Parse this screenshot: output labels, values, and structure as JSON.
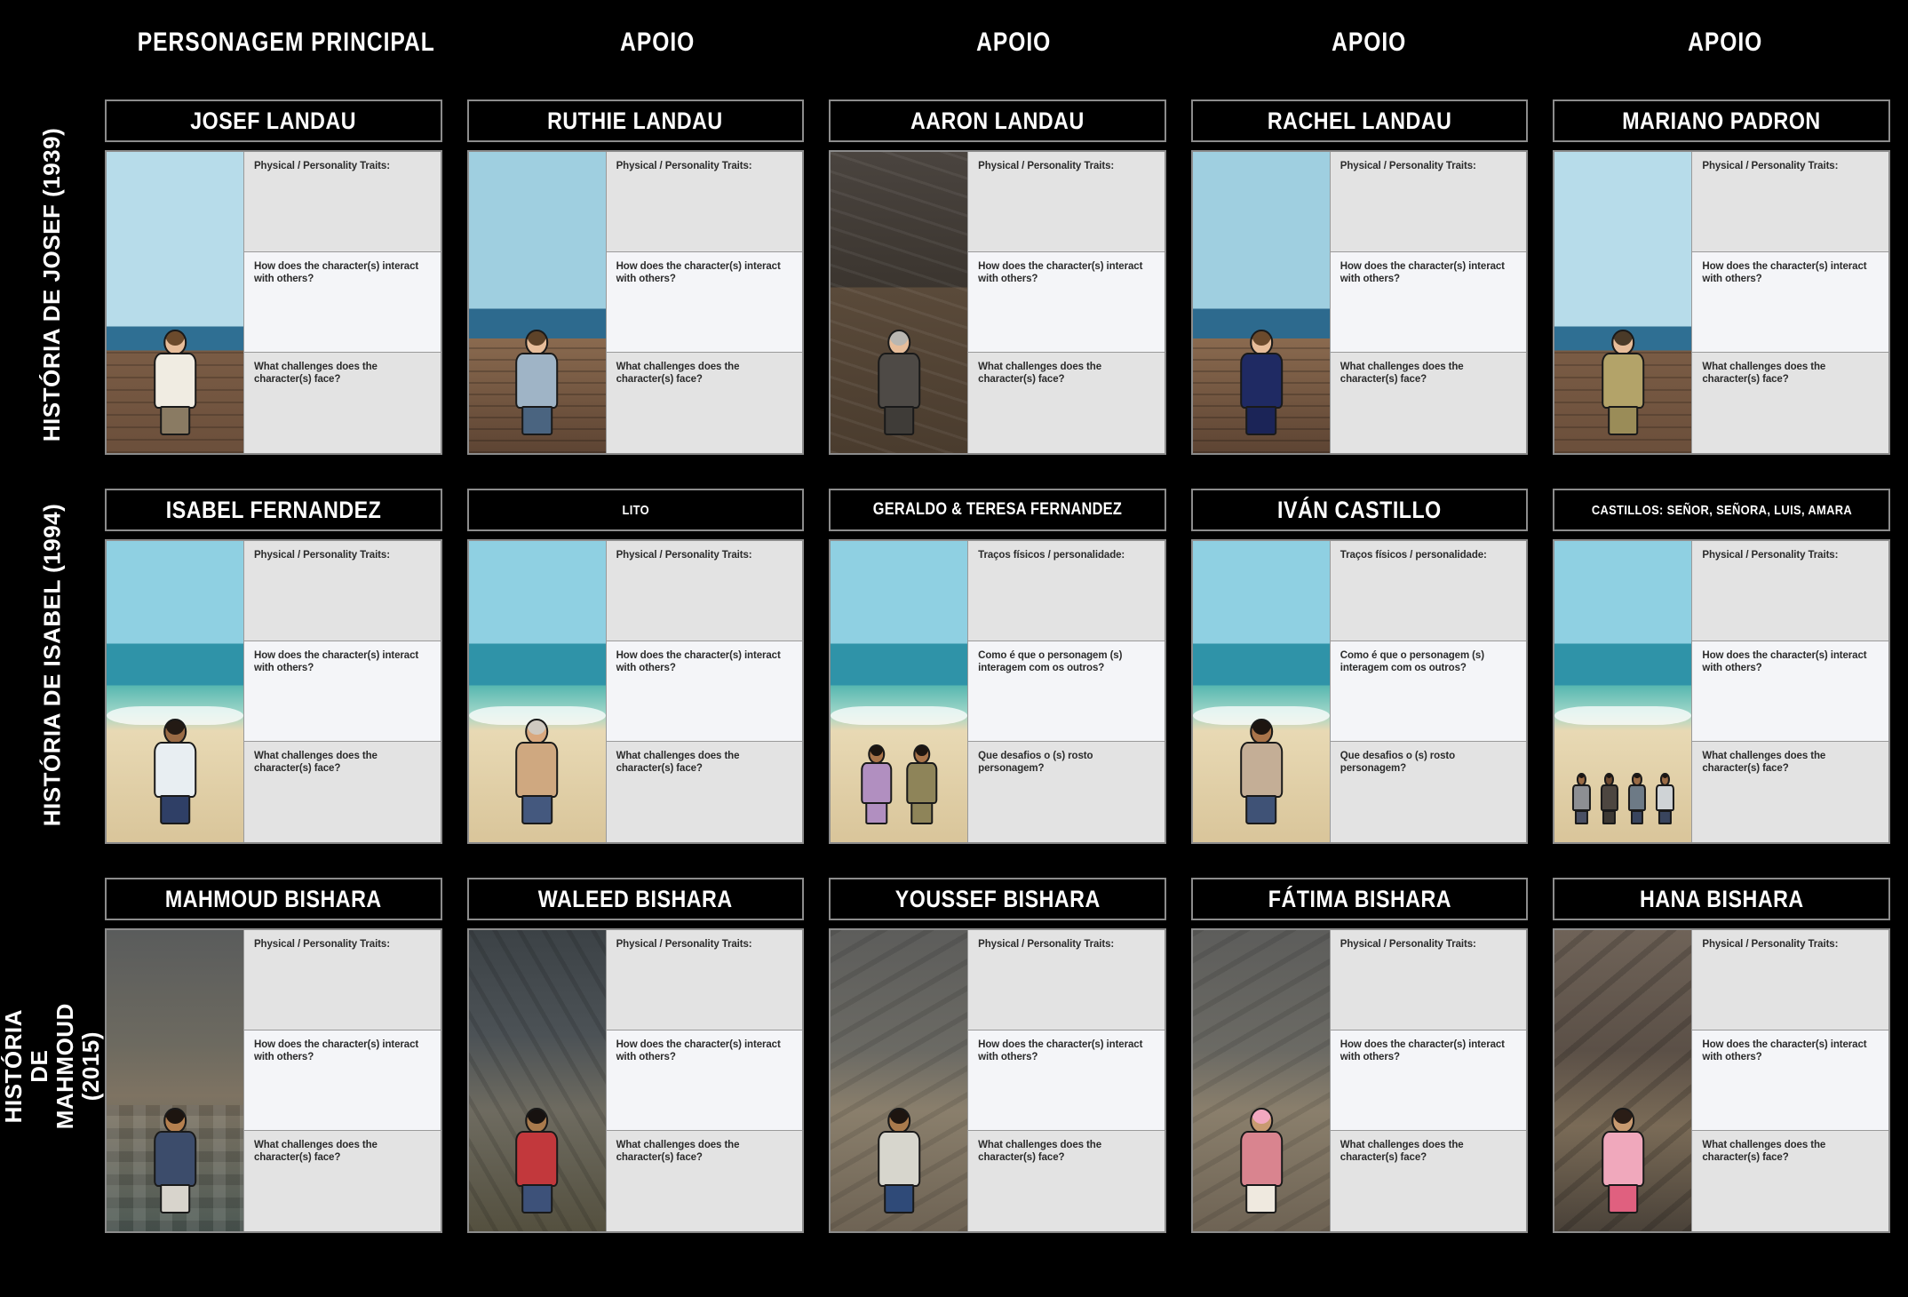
{
  "columns": [
    {
      "label": "PERSONAGEM PRINCIPAL"
    },
    {
      "label": "APOIO"
    },
    {
      "label": "APOIO"
    },
    {
      "label": "APOIO"
    },
    {
      "label": "APOIO"
    }
  ],
  "rows": [
    {
      "label": "HISTÓRIA DE JOSEF (1939)"
    },
    {
      "label": "HISTÓRIA DE ISABEL (1994)"
    },
    {
      "label": "HISTÓRIA DE MAHMOUD (2015)"
    }
  ],
  "prompts": {
    "en": {
      "traits": "Physical / Personality Traits:",
      "interact": "How does the character(s) interact with others?",
      "challenges": "What challenges does the character(s) face?"
    },
    "pt": {
      "traits": "Traços físicos / personalidade:",
      "interact": "Como é que o personagem (s) interagem com os outros?",
      "challenges": "Que desafios o (s) rosto personagem?"
    }
  },
  "cells": [
    {
      "title": "JOSEF LANDAU",
      "title_size": "normal",
      "lang": "en",
      "scene": "sc-ship-sky",
      "figure": "single",
      "colors": {
        "skin": "#e7bd9a",
        "hair": "#6b4a2c",
        "shirt": "#f0ece2",
        "pants": "#8a7b63"
      }
    },
    {
      "title": "RUTHIE LANDAU",
      "title_size": "normal",
      "lang": "en",
      "scene": "sc-ship-rail",
      "figure": "single",
      "colors": {
        "skin": "#e7bd9a",
        "hair": "#5d4228",
        "shirt": "#9fb4c6",
        "pants": "#4a6480"
      }
    },
    {
      "title": "AARON LANDAU",
      "title_size": "normal",
      "lang": "en",
      "scene": "sc-deck-dark",
      "figure": "single",
      "colors": {
        "skin": "#e7bd9a",
        "hair": "#b9b7b2",
        "shirt": "#4e4a46",
        "pants": "#3f3c38"
      }
    },
    {
      "title": "RACHEL LANDAU",
      "title_size": "normal",
      "lang": "en",
      "scene": "sc-ship-rail",
      "figure": "single",
      "colors": {
        "skin": "#e7bd9a",
        "hair": "#6b4a2c",
        "shirt": "#1f2a63",
        "pants": "#1b2457"
      }
    },
    {
      "title": "MARIANO PADRON",
      "title_size": "normal",
      "lang": "en",
      "scene": "sc-ship-sky",
      "figure": "single",
      "colors": {
        "skin": "#e7bd9a",
        "hair": "#4a3a28",
        "shirt": "#b3a369",
        "pants": "#9a8c58"
      }
    },
    {
      "title": "ISABEL FERNANDEZ",
      "title_size": "normal",
      "lang": "en",
      "scene": "sc-beach",
      "figure": "single",
      "colors": {
        "skin": "#9a6b45",
        "hair": "#231a14",
        "shirt": "#e8eef2",
        "pants": "#2f3f66"
      }
    },
    {
      "title": "LITO",
      "title_size": "small",
      "lang": "en",
      "scene": "sc-beach",
      "figure": "single",
      "colors": {
        "skin": "#d9a87e",
        "hair": "#cfc9c0",
        "shirt": "#cfa880",
        "pants": "#44587e"
      }
    },
    {
      "title": "GERALDO & TERESA FERNANDEZ",
      "title_size": "medium",
      "lang": "pt",
      "scene": "sc-beach",
      "figure": "pair",
      "colors": {
        "skin": "#a9744a",
        "hair": "#1d1510",
        "shirt": "#b18fc0",
        "pants": "#8e8459"
      }
    },
    {
      "title": "IVÁN CASTILLO",
      "title_size": "normal",
      "lang": "pt",
      "scene": "sc-beach",
      "figure": "single",
      "colors": {
        "skin": "#a9744a",
        "hair": "#1d1510",
        "shirt": "#c4ae96",
        "pants": "#3f5276"
      }
    },
    {
      "title": "CASTILLOS: SEÑOR, SEÑORA, LUIS, AMARA",
      "title_size": "small",
      "lang": "en",
      "scene": "sc-beach",
      "figure": "group",
      "colors": {
        "skin": "#9a6b45",
        "hair": "#1d1510",
        "shirt": "#cfd3d6",
        "pants": "#39455e"
      }
    },
    {
      "title": "MAHMOUD BISHARA",
      "title_size": "normal",
      "lang": "en",
      "scene": "sc-ruin-floor",
      "figure": "single",
      "colors": {
        "skin": "#b5804f",
        "hair": "#1d1510",
        "shirt": "#3c4c6b",
        "pants": "#d8d4cc"
      }
    },
    {
      "title": "WALEED BISHARA",
      "title_size": "normal",
      "lang": "en",
      "scene": "sc-storm",
      "figure": "single",
      "colors": {
        "skin": "#a97a4c",
        "hair": "#171210",
        "shirt": "#c2383c",
        "pants": "#3d5179"
      }
    },
    {
      "title": "YOUSSEF BISHARA",
      "title_size": "normal",
      "lang": "en",
      "scene": "sc-rubble",
      "figure": "single",
      "colors": {
        "skin": "#a97a4c",
        "hair": "#1d1510",
        "shirt": "#d7d6cd",
        "pants": "#2f4a78"
      }
    },
    {
      "title": "FÁTIMA BISHARA",
      "title_size": "normal",
      "lang": "en",
      "scene": "sc-rubble",
      "figure": "single",
      "colors": {
        "skin": "#c89a70",
        "hair": "#f2a8c0",
        "shirt": "#d9848f",
        "pants": "#efe9df"
      }
    },
    {
      "title": "HANA BISHARA",
      "title_size": "normal",
      "lang": "en",
      "scene": "sc-cave",
      "figure": "single",
      "colors": {
        "skin": "#c89a70",
        "hair": "#2a1d16",
        "shirt": "#f0a8bc",
        "pants": "#e0607f"
      }
    }
  ]
}
